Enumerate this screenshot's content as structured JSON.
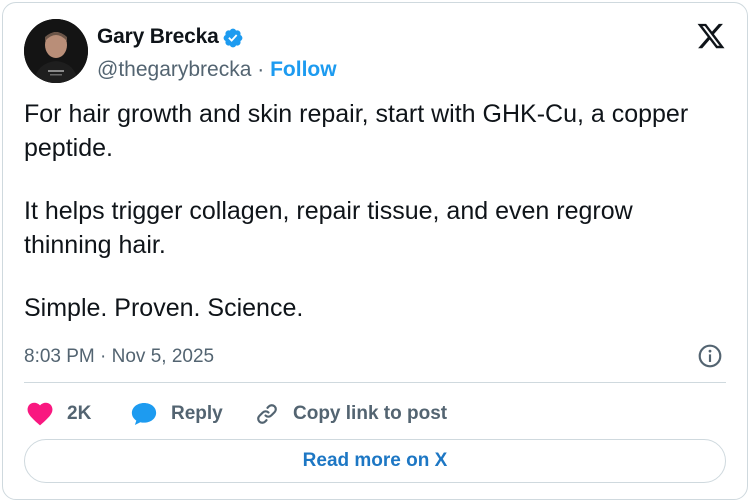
{
  "author": {
    "name": "Gary Brecka",
    "handle": "@thegarybrecka",
    "separator": "·",
    "follow_label": "Follow"
  },
  "tweet": {
    "paragraphs": [
      "For hair growth and skin repair, start with GHK-Cu, a copper peptide.",
      "It helps trigger collagen, repair tissue, and even regrow thinning hair.",
      "Simple. Proven. Science."
    ],
    "timestamp": "8:03 PM · Nov 5, 2025"
  },
  "actions": {
    "like_count": "2K",
    "reply_label": "Reply",
    "copy_label": "Copy link to post"
  },
  "read_more_label": "Read more on X",
  "colors": {
    "accent": "#1d9bf0",
    "like": "#f91880",
    "text": "#0f1419",
    "muted": "#536471",
    "border": "#cfd9de"
  },
  "icons": {
    "verified": "verified-badge-icon",
    "logo": "x-logo-icon",
    "info": "info-icon",
    "like": "heart-icon",
    "reply": "speech-bubble-icon",
    "copy": "link-icon"
  }
}
